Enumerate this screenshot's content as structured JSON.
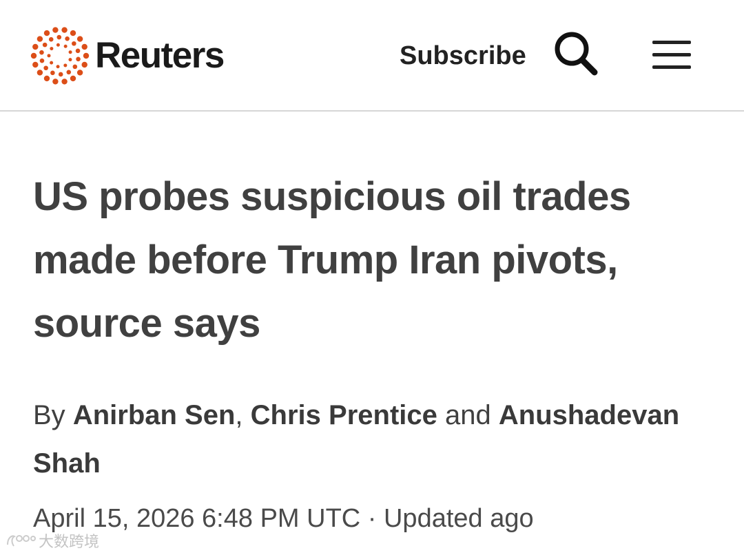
{
  "header": {
    "brand": "Reuters",
    "subscribe_label": "Subscribe",
    "brand_color": "#dc4e18",
    "icons": [
      "reuters-logo-icon",
      "search-icon",
      "menu-icon"
    ]
  },
  "article": {
    "headline": "US probes suspicious oil trades made before Trump Iran pivots, source says",
    "byline": {
      "prefix": "By",
      "author1": "Anirban Sen",
      "sep1": ",",
      "author2": "Chris Prentice",
      "and": "and",
      "author3": "Anushadevan Shah"
    },
    "dateline": "April 15, 2026 6:48 PM UTC · Updated ago"
  },
  "watermark": {
    "text": "大数跨境"
  }
}
